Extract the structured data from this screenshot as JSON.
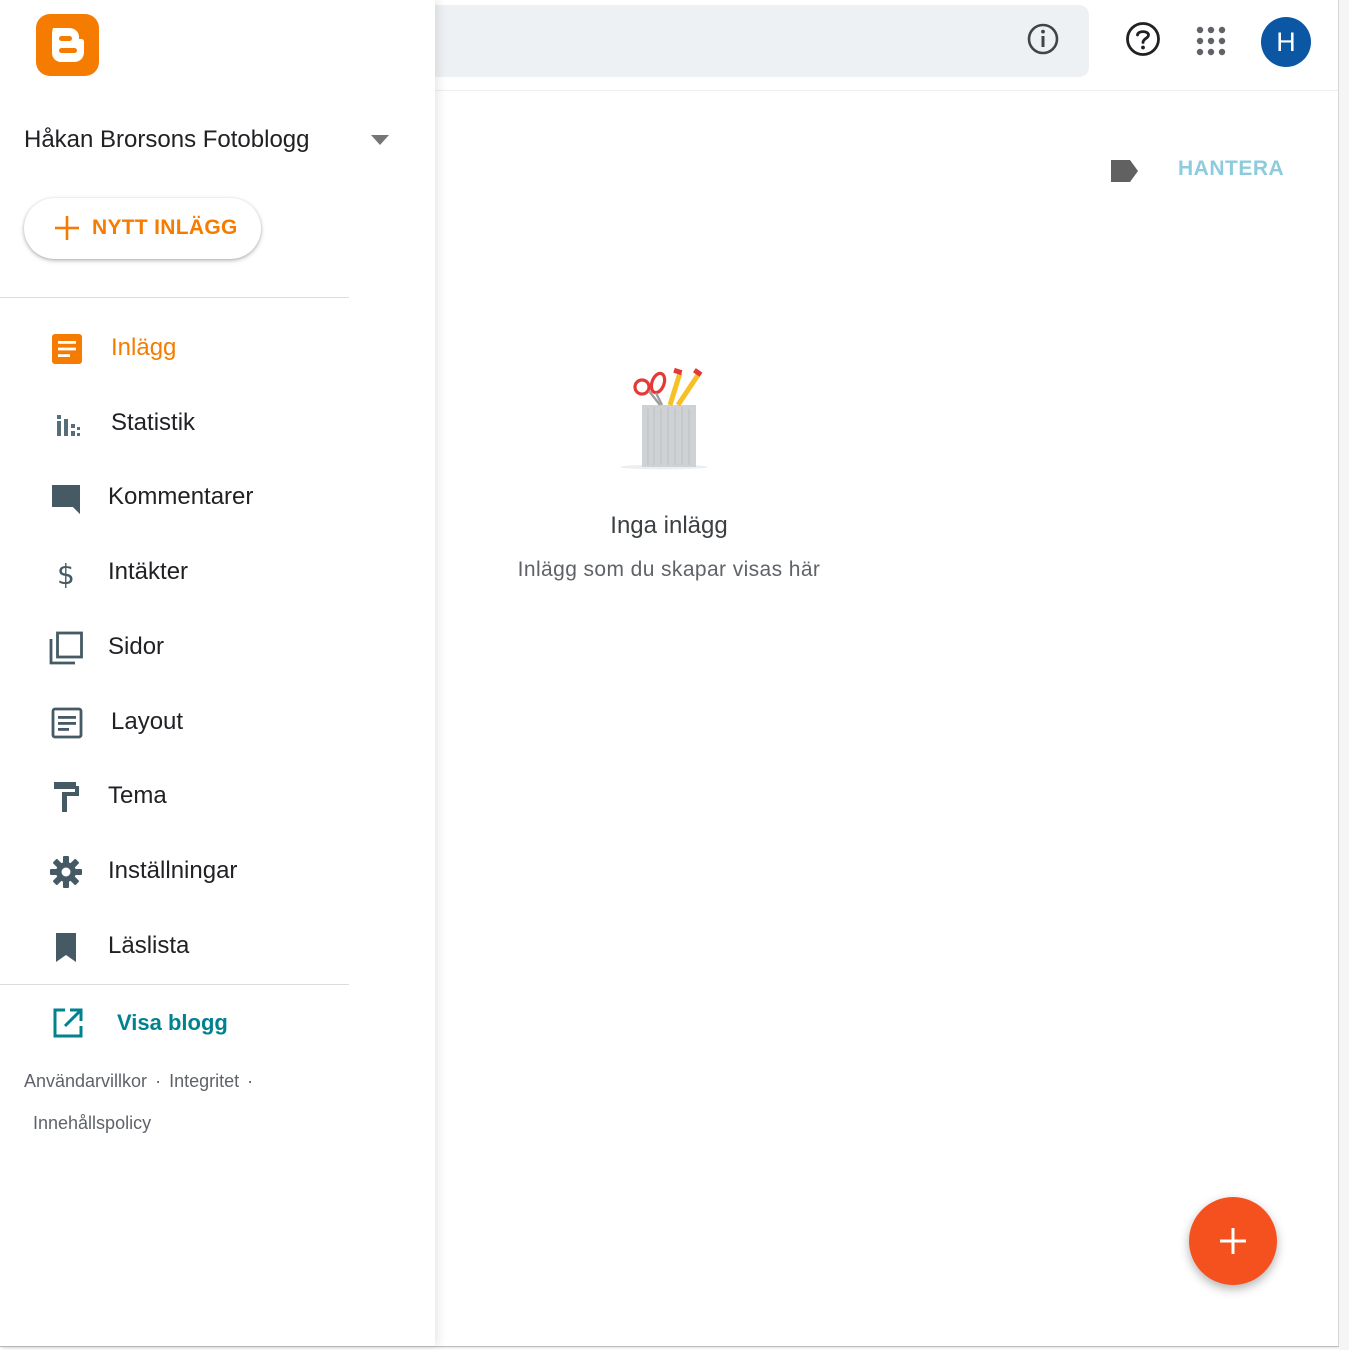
{
  "blog": {
    "title": "Håkan Brorsons Fotoblogg"
  },
  "new_post": {
    "label": "NYTT INLÄGG"
  },
  "nav": {
    "items": [
      {
        "label": "Inlägg",
        "icon": "posts-icon"
      },
      {
        "label": "Statistik",
        "icon": "stats-icon"
      },
      {
        "label": "Kommentarer",
        "icon": "comment-icon"
      },
      {
        "label": "Intäkter",
        "icon": "dollar-icon"
      },
      {
        "label": "Sidor",
        "icon": "pages-icon"
      },
      {
        "label": "Layout",
        "icon": "layout-icon"
      },
      {
        "label": "Tema",
        "icon": "theme-roller-icon"
      },
      {
        "label": "Inställningar",
        "icon": "gear-icon"
      },
      {
        "label": "Läslista",
        "icon": "bookmark-icon"
      }
    ],
    "view_blog": "Visa blogg"
  },
  "footer": {
    "terms": "Användarvillkor",
    "privacy": "Integritet",
    "content_policy": "Innehållspolicy",
    "dot": "·"
  },
  "header": {
    "avatar_letter": "H"
  },
  "labels": {
    "manage": "HANTERA"
  },
  "empty": {
    "title": "Inga inlägg",
    "subtitle": "Inlägg som du skapar visas här"
  },
  "colors": {
    "brand_orange": "#f57c00",
    "fab": "#f4511e",
    "avatar": "#0b57a4",
    "link_teal": "#00838f",
    "manage": "#8ecbdd"
  }
}
